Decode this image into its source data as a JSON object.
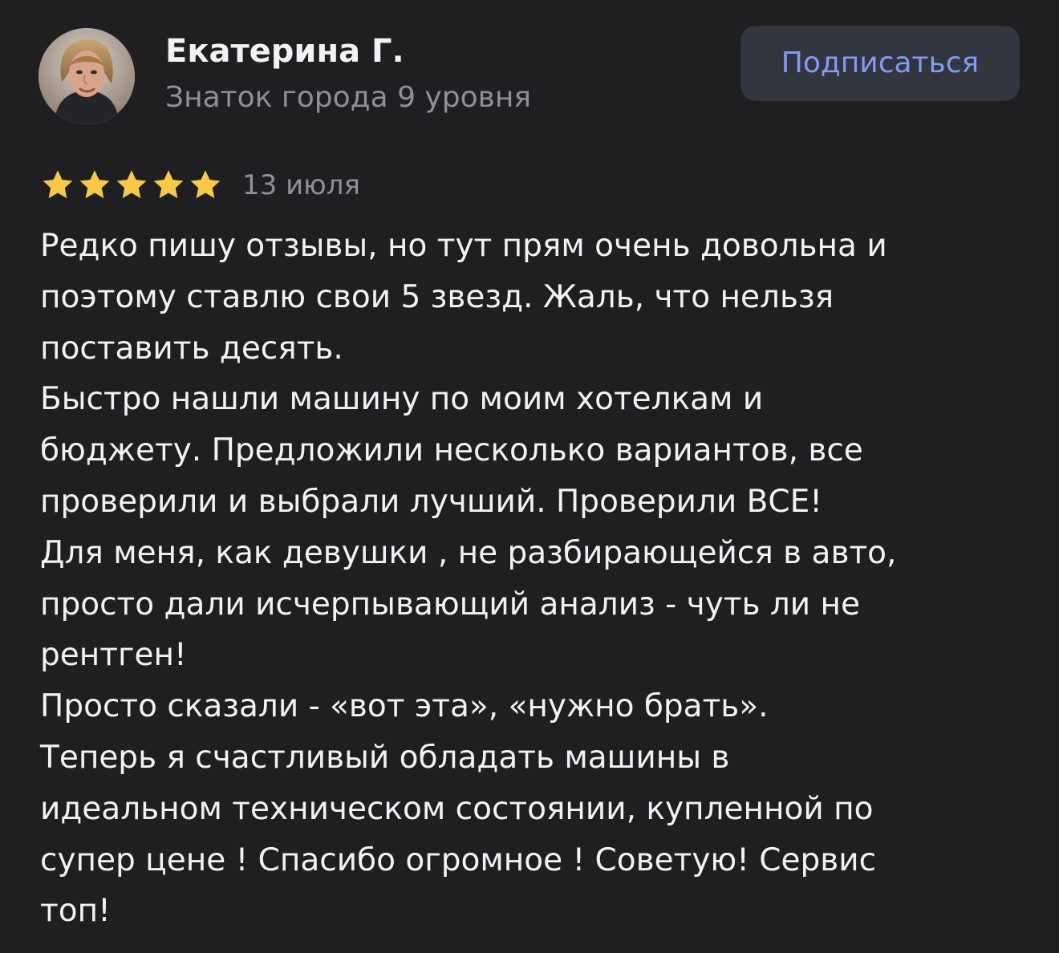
{
  "author": {
    "name": "Екатерина Г.",
    "level": "Знаток города 9 уровня",
    "avatar_icon": "user-avatar-photo"
  },
  "subscribe_button": {
    "label": "Подписаться",
    "color": "#7f9bf5",
    "background": "#33353f"
  },
  "review": {
    "rating": 5,
    "rating_max": 5,
    "star_color": "#f7c948",
    "date": "13 июля",
    "lines": [
      "Редко пишу отзывы, но тут прям очень довольна и",
      "поэтому ставлю свои 5 звезд. Жаль, что нельзя",
      "поставить десять.",
      "Быстро нашли машину по моим хотелкам и",
      "бюджету. Предложили несколько вариантов, все",
      "проверили и выбрали лучший. Проверили ВСЕ!",
      "Для меня, как девушки , не разбирающейся в авто,",
      "просто дали исчерпывающий анализ - чуть ли не",
      "рентген!",
      "Просто сказали - «вот эта», «нужно брать».",
      "Теперь я счастливый обладать машины в",
      "идеальном техническом состоянии, купленной по",
      "супер цене ! Спасибо огромное ! Советую! Сервис",
      "топ!"
    ]
  },
  "theme": {
    "background": "#1f1f22",
    "text": "#f2f2f4",
    "secondary_text": "#8f8f96"
  }
}
